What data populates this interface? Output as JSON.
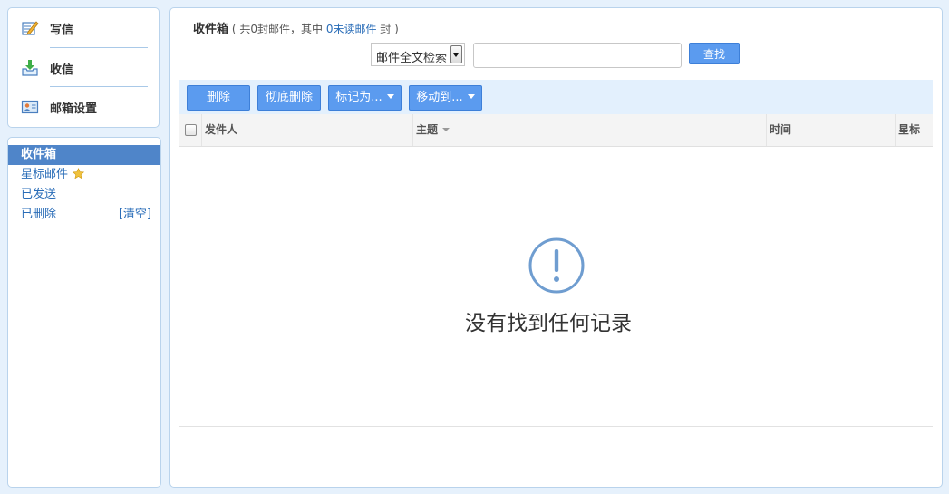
{
  "sidebar": {
    "actions": [
      {
        "label": "写信",
        "icon": "compose-icon"
      },
      {
        "label": "收信",
        "icon": "receive-mail-icon"
      },
      {
        "label": "邮箱设置",
        "icon": "mailbox-settings-icon"
      }
    ],
    "folders": [
      {
        "label": "收件箱",
        "active": true
      },
      {
        "label": "星标邮件",
        "icon": "star-icon"
      },
      {
        "label": "已发送"
      },
      {
        "label": "已删除",
        "action": "[清空]"
      }
    ]
  },
  "main": {
    "title": "收件箱",
    "summary_prefix": "( 共0封邮件，其中",
    "unread_link": "0未读邮件",
    "summary_suffix": "封 )",
    "search": {
      "select_value": "邮件全文检索",
      "input_value": "",
      "button_label": "查找"
    },
    "toolbar": {
      "delete_label": "删除",
      "delete_permanent_label": "彻底删除",
      "mark_as_label": "标记为...",
      "move_to_label": "移动到..."
    },
    "table": {
      "columns": [
        "发件人",
        "主题",
        "时间",
        "星标"
      ]
    },
    "empty_message": "没有找到任何记录"
  },
  "colors": {
    "accent": "#5b9bef",
    "active_folder": "#4f85c9",
    "link": "#2a6db8",
    "empty_icon": "#6f9dd0",
    "star": "#f0c23c"
  }
}
